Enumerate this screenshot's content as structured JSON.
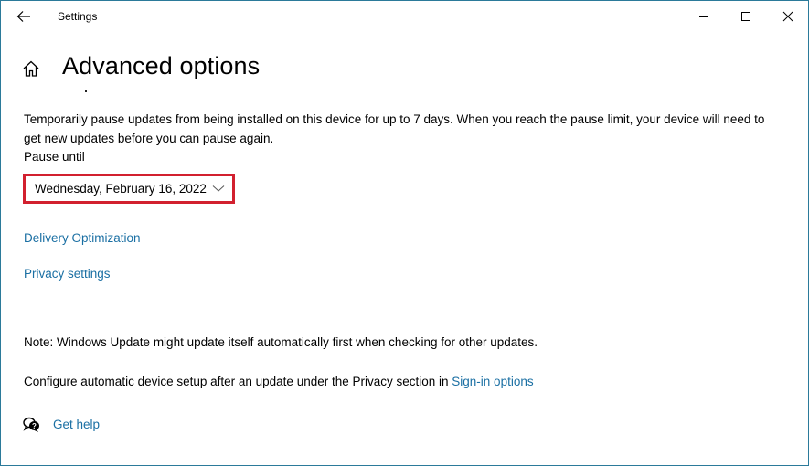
{
  "window": {
    "title": "Settings",
    "controls": [
      "minimize",
      "maximize",
      "close"
    ]
  },
  "header": {
    "title": "Advanced options"
  },
  "pause": {
    "description": "Temporarily pause updates from being installed on this device for up to 7 days. When you reach the pause limit, your device will need to get new updates before you can pause again.",
    "label": "Pause until",
    "selected_date": "Wednesday, February 16, 2022",
    "highlight_color": "#d2202f"
  },
  "links": {
    "delivery_optimization": "Delivery Optimization",
    "privacy_settings": "Privacy settings"
  },
  "note": "Note: Windows Update might update itself automatically first when checking for other updates.",
  "configure": {
    "text": "Configure automatic device setup after an update under the Privacy section in ",
    "link": "Sign-in options"
  },
  "help": {
    "label": "Get help"
  },
  "colors": {
    "accent_link": "#1a6fa3",
    "window_border": "#2b7a9a"
  }
}
